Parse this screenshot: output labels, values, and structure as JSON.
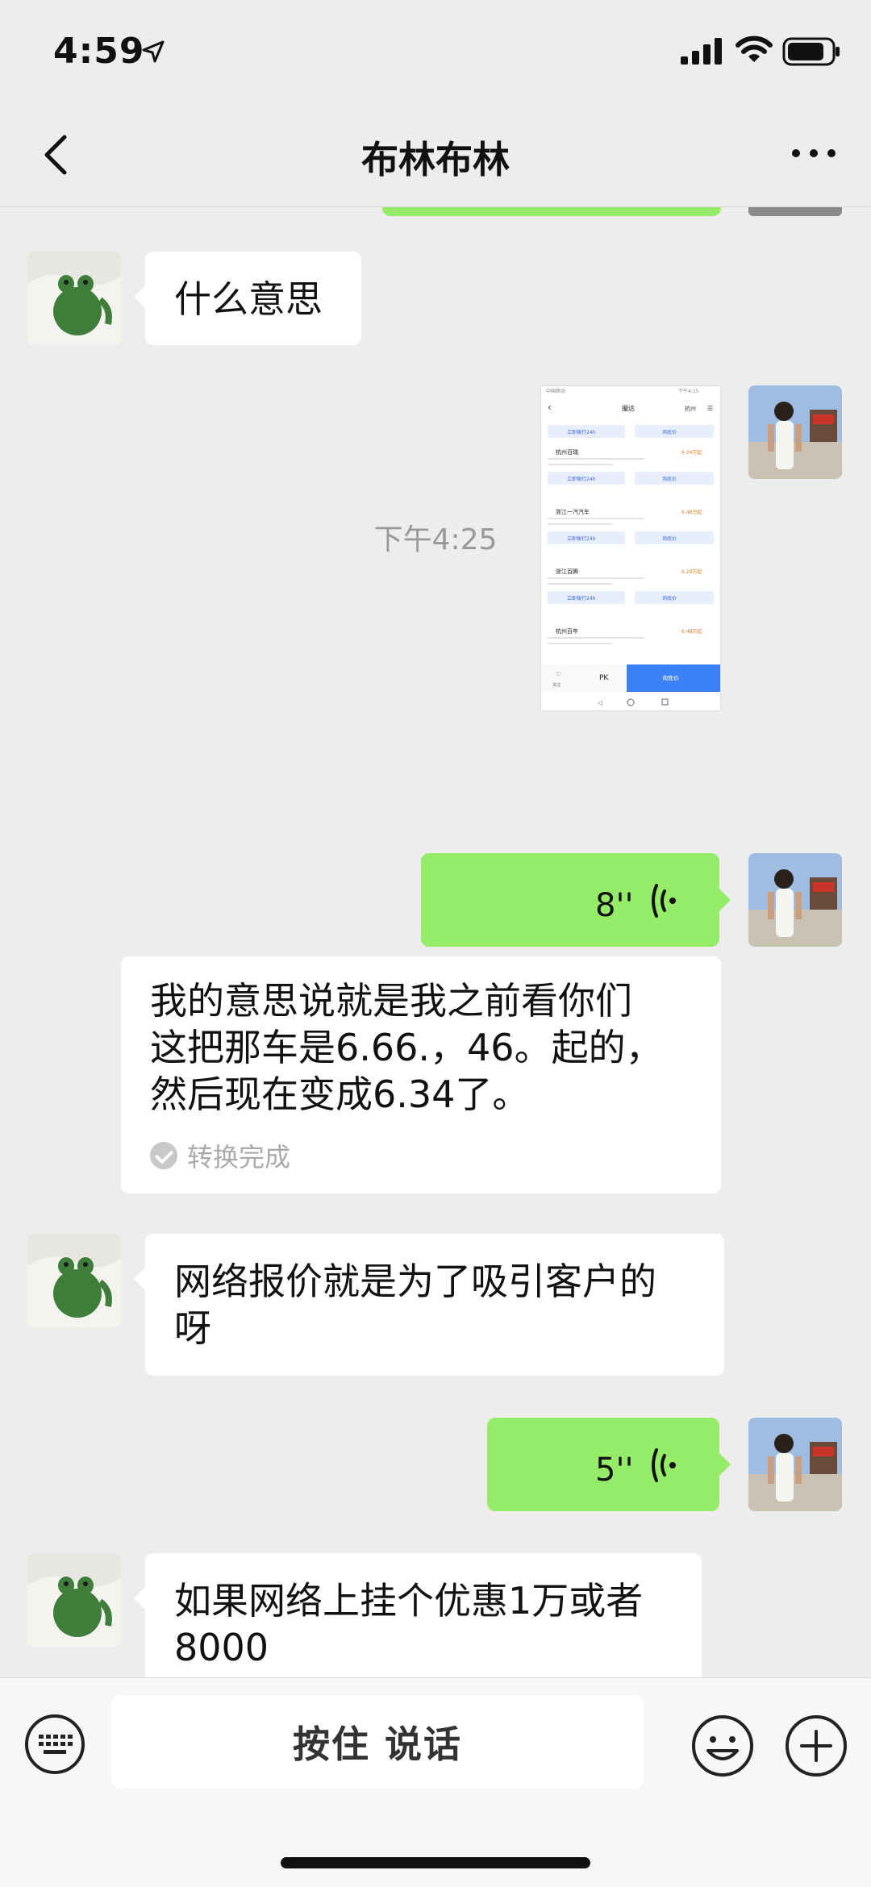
{
  "status_bar": {
    "time": "4:59"
  },
  "nav": {
    "title": "布林布林"
  },
  "messages": {
    "m1": "什么意思",
    "divider_time": "下午4:25",
    "voice1_duration": "8''",
    "transcript": [
      "我的意思说就是我之前看你们",
      "这把那车是6.66.，46。起的，",
      "然后现在变成6.34了。"
    ],
    "transcript_status": "转换完成",
    "m2": [
      "网络报价就是为了吸引客户的",
      "呀"
    ],
    "voice2_duration": "5''",
    "m3": [
      "如果网络上挂个优惠1万或者",
      "8000"
    ]
  },
  "screenshot": {
    "city": "杭州",
    "tab": "撮达",
    "dealers": [
      {
        "name": "杭州百瑞",
        "price": "6.34万起"
      },
      {
        "name": "浙江一汽汽车",
        "price": "6.48万起"
      },
      {
        "name": "浙江百腾",
        "price": "6.29万起"
      },
      {
        "name": "杭州百年",
        "price": "6.48万起"
      }
    ],
    "call_label": "立即拨打24h",
    "inquiry_label": "询底价",
    "bottom": {
      "fav": "关注",
      "pk": "PK",
      "cta": "询底价"
    }
  },
  "input_bar": {
    "hold_to_talk": "按住 说话"
  },
  "colors": {
    "bubble_green": "#95ec69",
    "background": "#ededed"
  }
}
